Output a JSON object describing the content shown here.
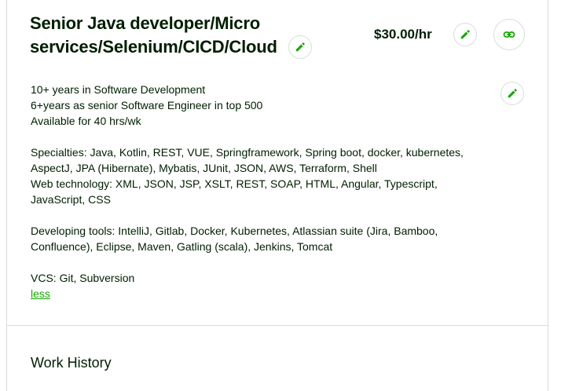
{
  "profile": {
    "title": "Senior Java developer/Micro services/Selenium/CICD/Cloud",
    "hourly_rate": "$30.00/hr",
    "overview_lines": [
      "10+ years in Software Development",
      "6+years as senior Software Engineer in top 500",
      "Available for 40 hrs/wk",
      "",
      "Specialties: Java, Kotlin, REST, VUE, Springframework, Spring boot, docker, kubernetes,",
      "AspectJ, JPA (Hibernate), Mybatis, JUnit, JSON, AWS, Terraform, Shell",
      "Web technology: XML, JSON, JSP, XSLT, REST, SOAP, HTML, Angular, Typescript,",
      "JavaScript, CSS",
      "",
      "Developing tools: IntelliJ, Gitlab, Docker, Kubernetes, Atlassian suite (Jira, Bamboo,",
      "Confluence), Eclipse, Maven, Gatling (scala), Jenkins, Tomcat",
      "",
      "VCS: Git, Subversion"
    ],
    "less_label": "less"
  },
  "work_history": {
    "heading": "Work History"
  },
  "icons": {
    "edit": "pencil-icon",
    "link": "link-icon"
  },
  "colors": {
    "accent": "#14a800",
    "text": "#001e00",
    "border": "#d5e0d5"
  }
}
